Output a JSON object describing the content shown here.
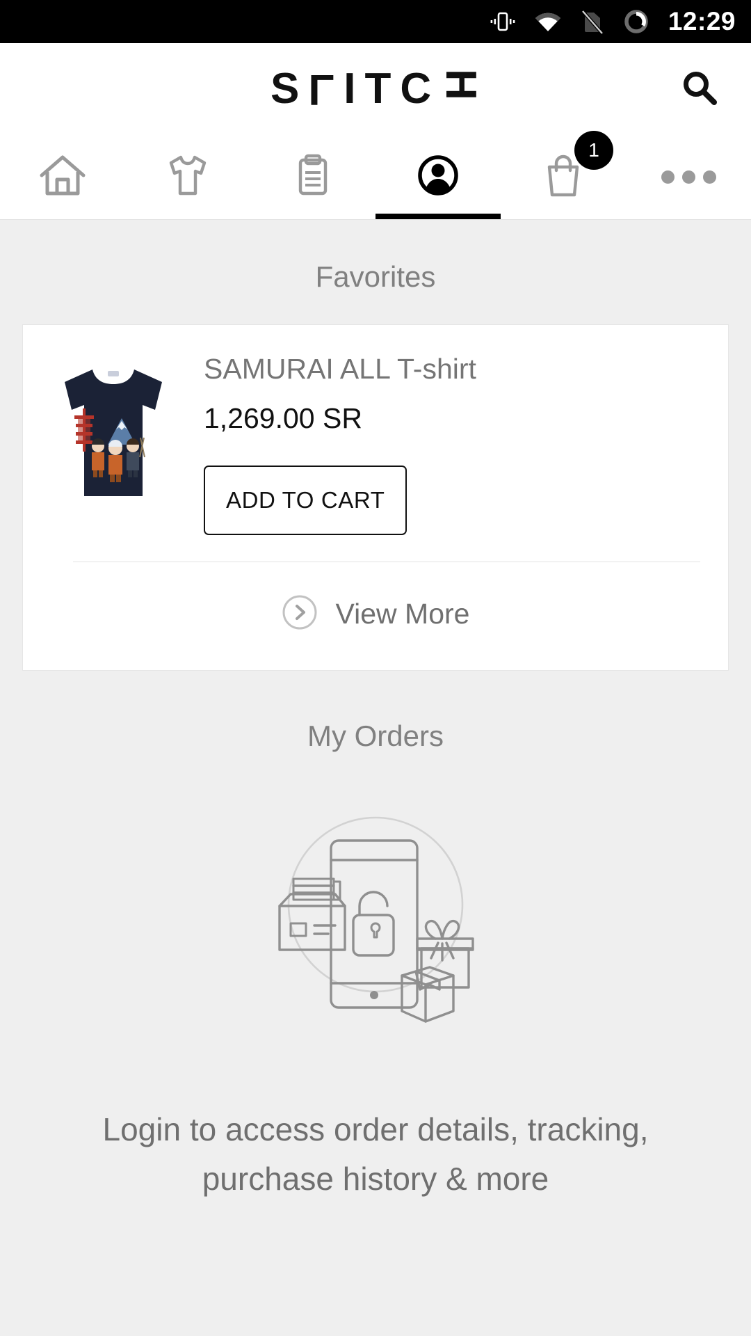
{
  "statusbar": {
    "time": "12:29",
    "icons": [
      "vibrate-icon",
      "wifi-icon",
      "no-sim-icon",
      "battery-circle-icon"
    ]
  },
  "header": {
    "logo_text": "SLITCH",
    "logo_letters": [
      "S",
      "L",
      "I",
      "T",
      "C",
      "H"
    ],
    "search_icon": "search-icon"
  },
  "nav": {
    "items": [
      {
        "id": "home",
        "icon": "home-icon",
        "active": false
      },
      {
        "id": "products",
        "icon": "tshirt-icon",
        "active": false
      },
      {
        "id": "orders",
        "icon": "clipboard-icon",
        "active": false
      },
      {
        "id": "account",
        "icon": "person-circle-icon",
        "active": true
      },
      {
        "id": "cart",
        "icon": "shopping-bag-icon",
        "active": false,
        "badge": "1"
      },
      {
        "id": "more",
        "icon": "more-dots-icon",
        "active": false
      }
    ]
  },
  "favorites": {
    "title": "Favorites",
    "product": {
      "name": "SAMURAI ALL T-shirt",
      "price": "1,269.00 SR",
      "add_to_cart_label": "ADD TO CART",
      "image_alt": "navy-tshirt-samurai-graphic"
    },
    "view_more_label": "View More",
    "view_more_icon": "chevron-right-circle-icon"
  },
  "orders": {
    "title": "My Orders",
    "illustration": "phone-lock-packages-illustration",
    "login_message": "Login to access order details, tracking, purchase history & more"
  },
  "colors": {
    "page_bg": "#efefef",
    "card_bg": "#ffffff",
    "accent": "#000000",
    "muted_text": "#757575",
    "shirt_navy": "#1b2236"
  }
}
